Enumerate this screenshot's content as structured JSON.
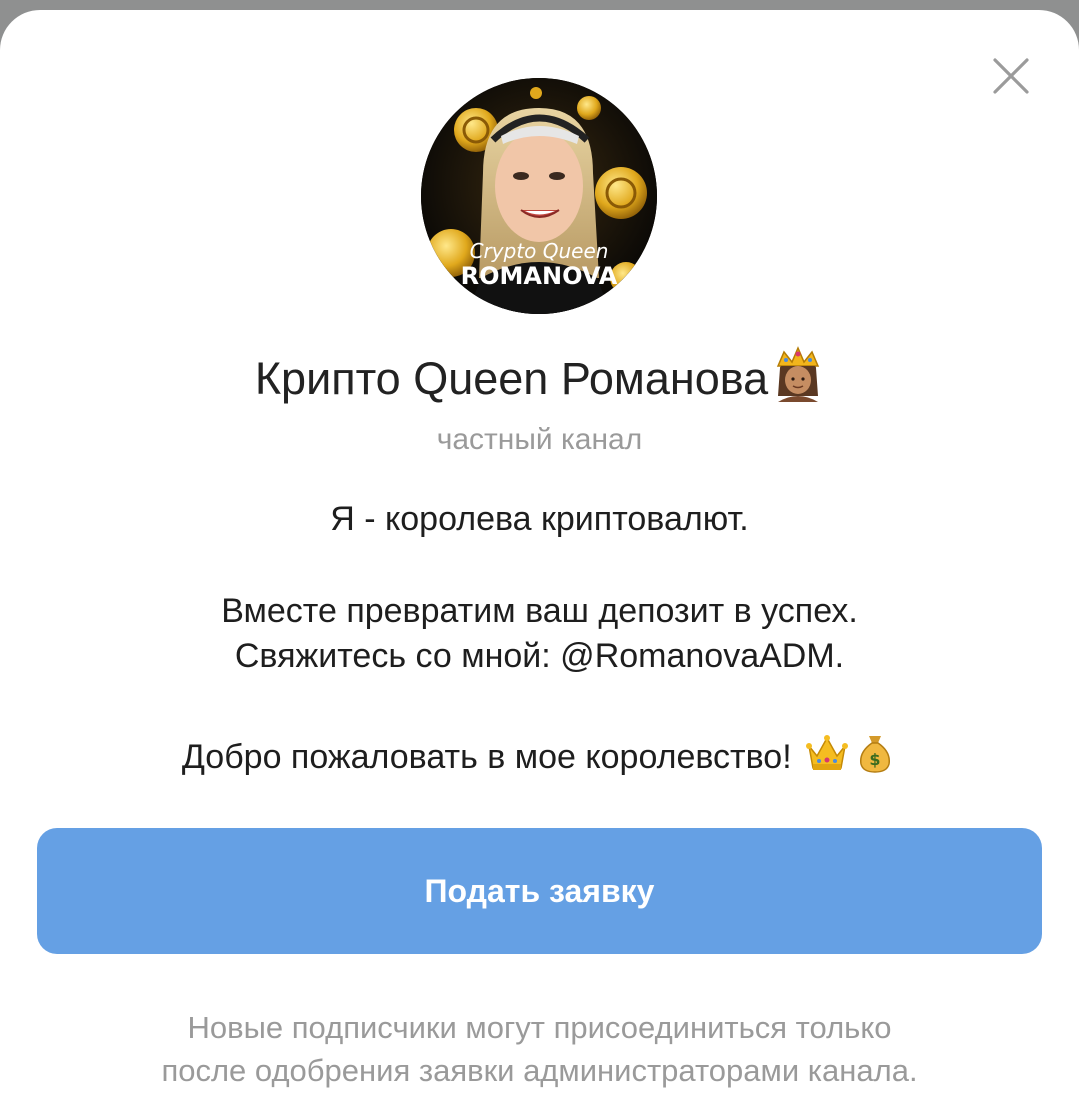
{
  "dialog": {
    "close_icon": "close-icon",
    "channel": {
      "avatar_text_top": "Crypto Queen",
      "avatar_text_bottom": "ROMANOVA",
      "title": "Крипто Queen Романова",
      "title_emoji": "crown-person-emoji",
      "type_label": "частный канал"
    },
    "description": {
      "line1": "Я - королева криптовалют.",
      "line2": "Вместе превратим ваш депозит в успех.",
      "line3": "Свяжитесь со мной: @RomanovaADM.",
      "line4": "Добро пожаловать в мое королевство!",
      "line4_emojis": [
        "crown-emoji",
        "money-bag-emoji"
      ]
    },
    "join_button_label": "Подать заявку",
    "footer": {
      "line1": "Новые подписчики могут присоединиться только",
      "line2": "после одобрения заявки администраторами канала."
    },
    "colors": {
      "accent": "#65a0e4",
      "title": "#222222",
      "secondary": "#9a9a9a"
    }
  }
}
